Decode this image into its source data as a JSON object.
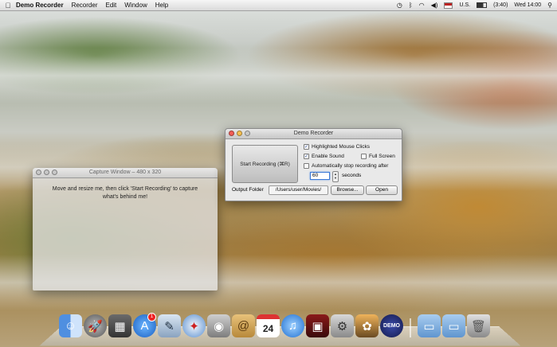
{
  "menubar": {
    "app_name": "Demo Recorder",
    "menus": [
      "Recorder",
      "Edit",
      "Window",
      "Help"
    ],
    "input_source": "U.S.",
    "battery": "(3:40)",
    "clock": "Wed 14:00"
  },
  "capture_window": {
    "title": "Capture Window – 480 x 320",
    "message": "Move and resize me, then click 'Start Recording' to capture what's behind me!"
  },
  "recorder": {
    "title": "Demo Recorder",
    "start_button": "Start Recording (⌘R)",
    "highlight_clicks": "Highlighted Mouse Clicks",
    "enable_sound": "Enable Sound",
    "full_screen": "Full Screen",
    "auto_stop": "Automatically stop recording after",
    "seconds_value": "60",
    "seconds_label": "seconds",
    "output_label": "Output Folder",
    "output_path": "/Users/user/Movies/",
    "browse": "Browse...",
    "open": "Open"
  },
  "dock": {
    "calendar_day": "24",
    "demo_label": "DEMO",
    "appstore_badge": "1"
  }
}
